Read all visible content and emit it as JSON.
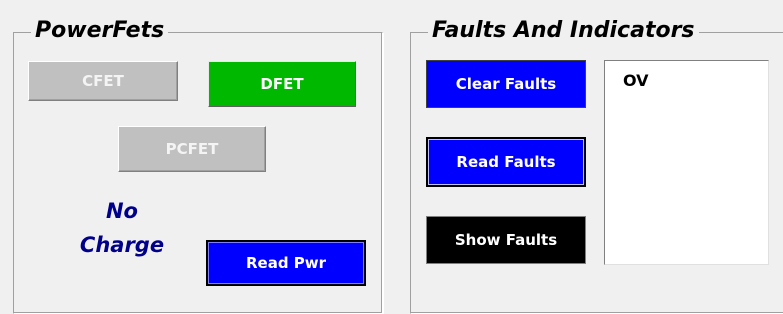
{
  "powerfets": {
    "title": "PowerFets",
    "cfet_label": "CFET",
    "dfet_label": "DFET",
    "pcfet_label": "PCFET",
    "status_line1": "No",
    "status_line2": "Charge",
    "read_pwr_label": "Read Pwr"
  },
  "faults": {
    "title": "Faults And Indicators",
    "clear_label": "Clear Faults",
    "read_label": "Read Faults",
    "show_label": "Show Faults",
    "list": [
      "OV"
    ]
  },
  "colors": {
    "fet_on": "#00b800",
    "fet_off": "#c0c0c0",
    "action_blue": "#0000ff",
    "status_text": "#00008b"
  }
}
